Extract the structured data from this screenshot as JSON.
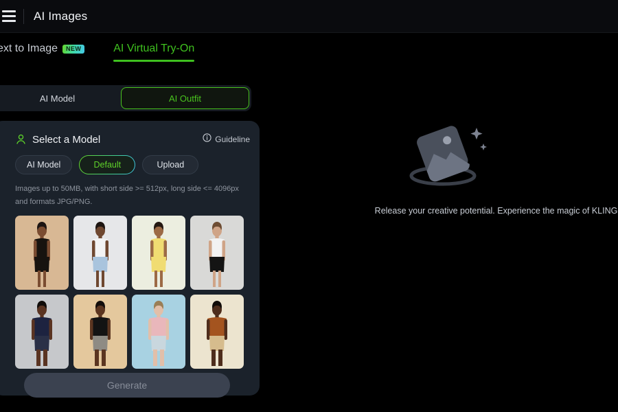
{
  "header": {
    "menu_icon": "list-menu-icon",
    "title": "AI Images"
  },
  "tabs": [
    {
      "label": "Text to Image",
      "badge": "NEW",
      "active": false
    },
    {
      "label": "AI Virtual Try-On",
      "badge": "",
      "active": true
    }
  ],
  "segmented": {
    "options": [
      {
        "label": "AI Model",
        "active": false
      },
      {
        "label": "AI Outfit",
        "active": true
      }
    ]
  },
  "panel": {
    "icon": "user-icon",
    "title": "Select a Model",
    "guideline": {
      "icon": "info-circle-icon",
      "label": "Guideline"
    },
    "source_chips": [
      {
        "label": "AI Model",
        "active": false
      },
      {
        "label": "Default",
        "active": true
      },
      {
        "label": "Upload",
        "active": false
      }
    ],
    "hint": "Images up to 50MB, with short side >= 512px, long side <= 4096px and formats JPG/PNG.",
    "models": [
      {
        "name": "model-black-dress",
        "bg": "#d8b894",
        "skin": "#7a4c31",
        "hair": "#1c1412",
        "top": "#17130f",
        "bottom": "#17130f",
        "gender": "f"
      },
      {
        "name": "model-white-tee-denim-shorts",
        "bg": "#e6e7e9",
        "skin": "#6f4830",
        "hair": "#1d1511",
        "top": "#f3f3f3",
        "bottom": "#a9c4dd",
        "gender": "f"
      },
      {
        "name": "model-yellow-set",
        "bg": "#eceee0",
        "skin": "#9c6a45",
        "hair": "#241812",
        "top": "#f0dc72",
        "bottom": "#f0dc72",
        "gender": "f"
      },
      {
        "name": "model-white-top-black-skirt",
        "bg": "#d9d9d7",
        "skin": "#cfa487",
        "hair": "#6d4c32",
        "top": "#f2f2f2",
        "bottom": "#141414",
        "gender": "f"
      },
      {
        "name": "model-navy-sweater",
        "bg": "#c6c8cb",
        "skin": "#5a3422",
        "hair": "#100c0a",
        "top": "#1d2340",
        "bottom": "#2a3047",
        "gender": "m"
      },
      {
        "name": "model-black-sweater-grey-pants",
        "bg": "#e4c89d",
        "skin": "#5b3520",
        "hair": "#120d0b",
        "top": "#131313",
        "bottom": "#8e8b84",
        "gender": "m"
      },
      {
        "name": "model-pink-tshirt",
        "bg": "#a8d2e2",
        "skin": "#e2bfa9",
        "hair": "#9a7e56",
        "top": "#e9b7bb",
        "bottom": "#c9d7de",
        "gender": "m"
      },
      {
        "name": "model-brown-jacket-khaki",
        "bg": "#ece4cf",
        "skin": "#4e2d1c",
        "hair": "#110c09",
        "top": "#a4541f",
        "bottom": "#d6bc8d",
        "gender": "m"
      }
    ]
  },
  "generate_button": {
    "label": "Generate",
    "enabled": false
  },
  "placeholder": {
    "icon": "image-sparkle-icon",
    "text": "Release your creative potential. Experience the magic of KLING"
  },
  "colors": {
    "accent_green": "#3fc11f",
    "accent_cyan": "#45c9e8",
    "page_bg": "#000000",
    "card_bg": "#1b222b",
    "header_bg": "#0a0b0e"
  }
}
